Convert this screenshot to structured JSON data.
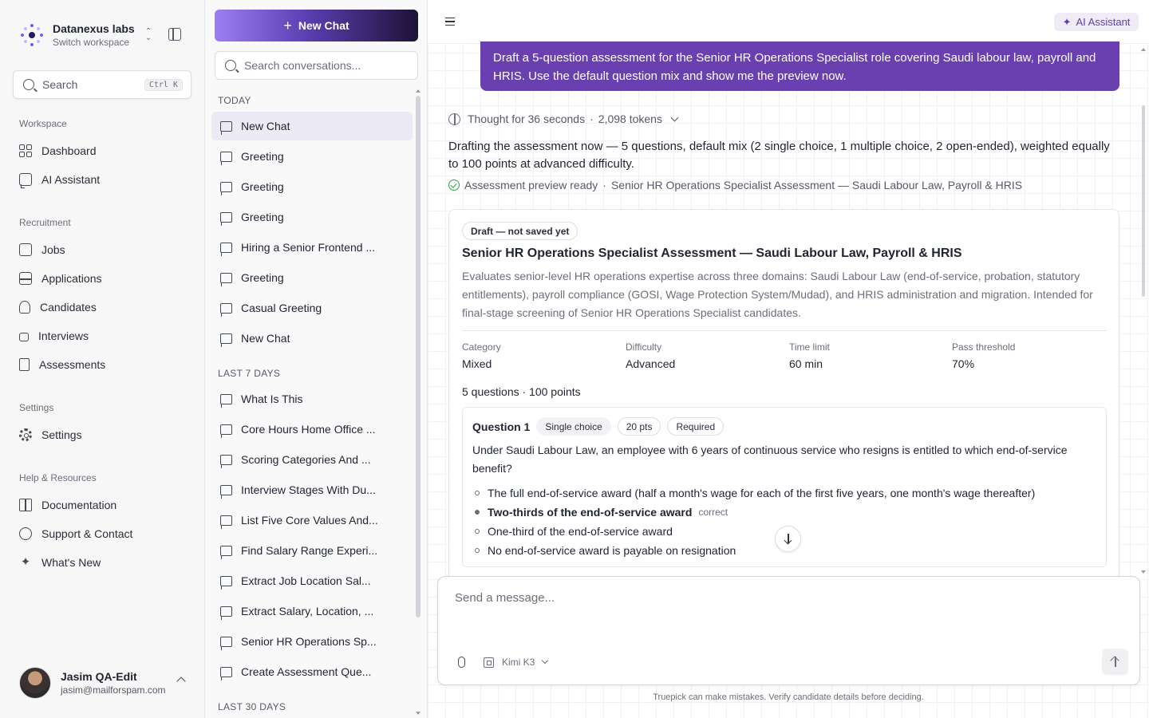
{
  "workspace": {
    "name": "Datanexus labs",
    "switch_label": "Switch workspace"
  },
  "sidebar": {
    "search_label": "Search",
    "search_shortcut": "Ctrl K",
    "sections": [
      {
        "title": "Workspace",
        "items": [
          {
            "label": "Dashboard",
            "icon": "dashboard-icon"
          },
          {
            "label": "AI Assistant",
            "icon": "chat-bubble-icon"
          }
        ]
      },
      {
        "title": "Recruitment",
        "items": [
          {
            "label": "Jobs",
            "icon": "briefcase-icon"
          },
          {
            "label": "Applications",
            "icon": "inbox-icon"
          },
          {
            "label": "Candidates",
            "icon": "users-icon"
          },
          {
            "label": "Interviews",
            "icon": "video-icon"
          },
          {
            "label": "Assessments",
            "icon": "clipboard-icon"
          }
        ]
      },
      {
        "title": "Settings",
        "items": [
          {
            "label": "Settings",
            "icon": "gear-icon"
          }
        ]
      },
      {
        "title": "Help & Resources",
        "items": [
          {
            "label": "Documentation",
            "icon": "book-icon"
          },
          {
            "label": "Support & Contact",
            "icon": "chat-bubble-icon"
          },
          {
            "label": "What's New",
            "icon": "sparkles-icon"
          }
        ]
      }
    ]
  },
  "user": {
    "name": "Jasim QA-Edit",
    "email": "jasim@mailforspam.com"
  },
  "conversations": {
    "new_chat_label": "New Chat",
    "search_placeholder": "Search conversations...",
    "groups": [
      {
        "title": "TODAY",
        "items": [
          "New Chat",
          "Greeting",
          "Greeting",
          "Greeting",
          "Hiring a Senior Frontend ...",
          "Greeting",
          "Casual Greeting",
          "New Chat"
        ]
      },
      {
        "title": "LAST 7 DAYS",
        "items": [
          "What Is This",
          "Core Hours Home Office ...",
          "Scoring Categories And ...",
          "Interview Stages With Du...",
          "List Five Core Values And...",
          "Find Salary Range Experi...",
          "Extract Job Location Sal...",
          "Extract Salary, Location, ...",
          "Senior HR Operations Sp...",
          "Create Assessment Que..."
        ]
      },
      {
        "title": "LAST 30 DAYS",
        "items": []
      }
    ]
  },
  "topbar": {
    "assistant_label": "AI Assistant"
  },
  "chat": {
    "user_message": "Draft a 5-question assessment for the Senior HR Operations Specialist role covering Saudi labour law, payroll and HRIS. Use the default question mix and show me the preview now.",
    "thought_text": "Thought for 36 seconds",
    "thought_sep": "·",
    "thought_tokens": "2,098  tokens",
    "reply": "Drafting the assessment now — 5 questions, default mix (2 single choice, 1 multiple choice, 2 open-ended), weighted equally to 100 points at advanced difficulty.",
    "status_label": "Assessment preview ready",
    "status_sep": "·",
    "status_title": "Senior HR Operations Specialist Assessment — Saudi Labour Law, Payroll & HRIS"
  },
  "assessment": {
    "badge": "Draft — not saved yet",
    "title": "Senior HR Operations Specialist Assessment — Saudi Labour Law, Payroll & HRIS",
    "description": "Evaluates senior-level HR operations expertise across three domains: Saudi Labour Law (end-of-service, probation, statutory entitlements), payroll compliance (GOSI, Wage Protection System/Mudad), and HRIS administration and migration. Intended for final-stage screening of Senior HR Operations Specialist candidates.",
    "meta": [
      {
        "key": "Category",
        "value": "Mixed"
      },
      {
        "key": "Difficulty",
        "value": "Advanced"
      },
      {
        "key": "Time limit",
        "value": "60 min"
      },
      {
        "key": "Pass threshold",
        "value": "70%"
      }
    ],
    "summary": "5 questions · 100 points",
    "question": {
      "label": "Question 1",
      "type": "Single choice",
      "points": "20 pts",
      "required": "Required",
      "text": "Under Saudi Labour Law, an employee with 6 years of continuous service who resigns is entitled to which end-of-service benefit?",
      "options": [
        {
          "text": "The full end-of-service award (half a month's wage for each of the first five years, one month's wage thereafter)",
          "correct": false
        },
        {
          "text": "Two-thirds of the end-of-service award",
          "correct": true
        },
        {
          "text": "One-third of the end-of-service award",
          "correct": false
        },
        {
          "text": "No end-of-service award is payable on resignation",
          "correct": false
        }
      ],
      "correct_tag": "correct"
    }
  },
  "composer": {
    "placeholder": "Send a message...",
    "model": "Kimi K3",
    "disclaimer": "Truepick can make mistakes. Verify candidate details before deciding."
  },
  "colors": {
    "accent": "#6a3fb0",
    "status_ok": "#2ea44f"
  }
}
